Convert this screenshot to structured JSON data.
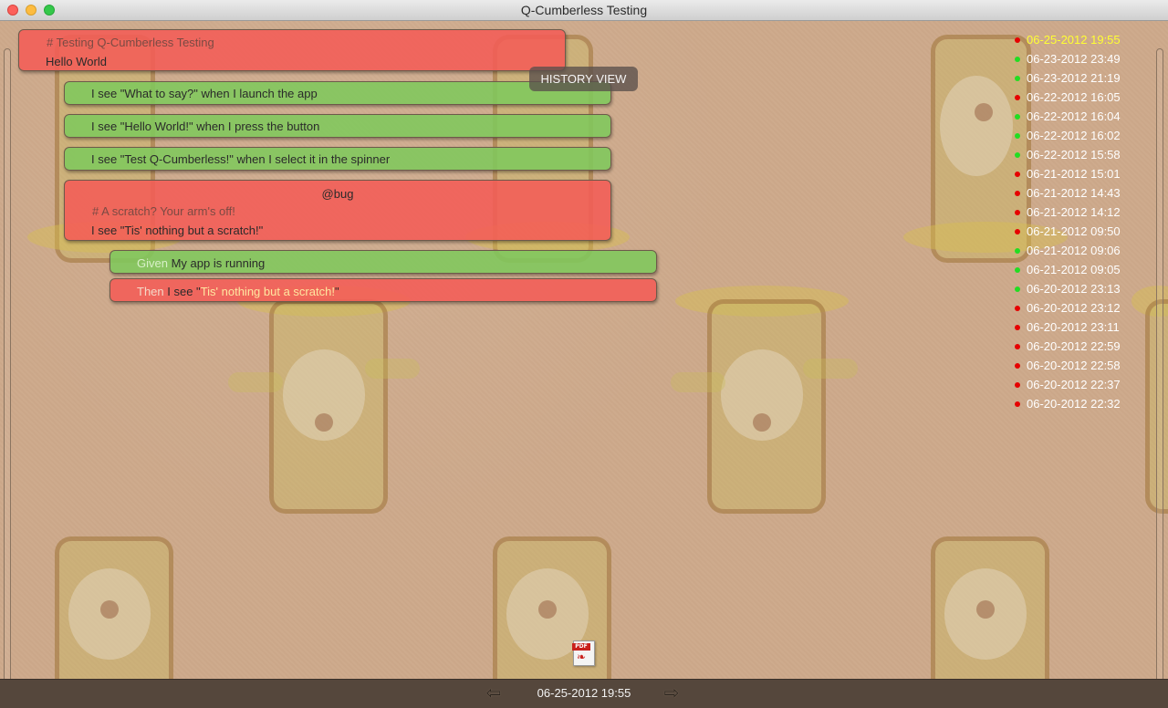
{
  "window": {
    "title": "Q-Cumberless Testing"
  },
  "overlay": {
    "history_view_label": "HISTORY VIEW"
  },
  "feature": {
    "comment": "# Testing Q-Cumberless Testing",
    "title": "Hello World",
    "status_color": "#f45c56"
  },
  "scenarios": [
    {
      "text": "I see \"What to say?\" when I launch the app",
      "status": "pass"
    },
    {
      "text": "I see \"Hello World!\" when I press the button",
      "status": "pass"
    },
    {
      "text": "I see \"Test Q-Cumberless!\" when I select it in the spinner",
      "status": "pass"
    }
  ],
  "bug_scenario": {
    "tag": "@bug",
    "comment": "# A scratch? Your arm's off!",
    "text": "I see \"Tis' nothing but a scratch!\"",
    "status": "fail"
  },
  "steps": [
    {
      "keyword": "Given",
      "text": "My app is running",
      "status": "pass"
    },
    {
      "keyword": "Then",
      "prefix": "I see \"",
      "highlight": "Tis' nothing but a scratch!",
      "suffix": "\"",
      "status": "fail"
    }
  ],
  "history": [
    {
      "date": "06-25-2012 19:55",
      "status": "fail",
      "active": true
    },
    {
      "date": "06-23-2012 23:49",
      "status": "pass"
    },
    {
      "date": "06-23-2012 21:19",
      "status": "pass"
    },
    {
      "date": "06-22-2012 16:05",
      "status": "fail"
    },
    {
      "date": "06-22-2012 16:04",
      "status": "pass"
    },
    {
      "date": "06-22-2012 16:02",
      "status": "pass"
    },
    {
      "date": "06-22-2012 15:58",
      "status": "pass"
    },
    {
      "date": "06-21-2012 15:01",
      "status": "fail"
    },
    {
      "date": "06-21-2012 14:43",
      "status": "fail"
    },
    {
      "date": "06-21-2012 14:12",
      "status": "fail"
    },
    {
      "date": "06-21-2012 09:50",
      "status": "fail"
    },
    {
      "date": "06-21-2012 09:06",
      "status": "pass"
    },
    {
      "date": "06-21-2012 09:05",
      "status": "pass"
    },
    {
      "date": "06-20-2012 23:13",
      "status": "pass"
    },
    {
      "date": "06-20-2012 23:12",
      "status": "fail"
    },
    {
      "date": "06-20-2012 23:11",
      "status": "fail"
    },
    {
      "date": "06-20-2012 22:59",
      "status": "fail"
    },
    {
      "date": "06-20-2012 22:58",
      "status": "fail"
    },
    {
      "date": "06-20-2012 22:37",
      "status": "fail"
    },
    {
      "date": "06-20-2012 22:32",
      "status": "fail"
    }
  ],
  "footer": {
    "current_date": "06-25-2012 19:55",
    "prev_icon": "arrow-left-icon",
    "next_icon": "arrow-right-icon",
    "export_icon": "pdf-icon",
    "pdf_label": "PDF"
  },
  "colors": {
    "fail": "#f45c56",
    "pass": "#80c85c",
    "active_history": "#ffff33"
  }
}
